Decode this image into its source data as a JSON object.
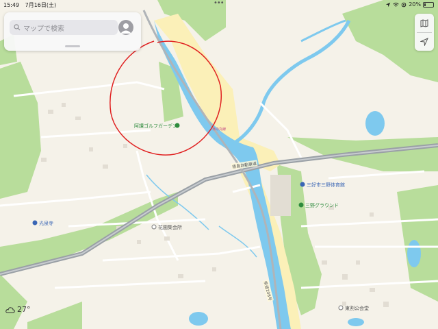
{
  "status_bar": {
    "time": "15:49",
    "date": "7月16日(土)",
    "battery": "20%",
    "battery_level": 0.2
  },
  "search": {
    "placeholder": "マップで検索"
  },
  "weather": {
    "temperature": "27°",
    "icon": "cloud-icon"
  },
  "places": {
    "golf": "阿讃ゴルフガーデン",
    "gym": "三好市三野体育館",
    "ground": "三野グラウンド",
    "temple": "光泉寺",
    "hanazono": "花園集会所",
    "higashiwari": "東割公会堂"
  },
  "roads": {
    "expressway": "徳島自動車道",
    "route": "県道108号",
    "small": "日の丸線"
  },
  "colors": {
    "land": "#f5f2e9",
    "forest": "#b8dd9b",
    "water": "#7ec9ee",
    "highway": "#9aa0a6",
    "annotation": "#e02020"
  }
}
